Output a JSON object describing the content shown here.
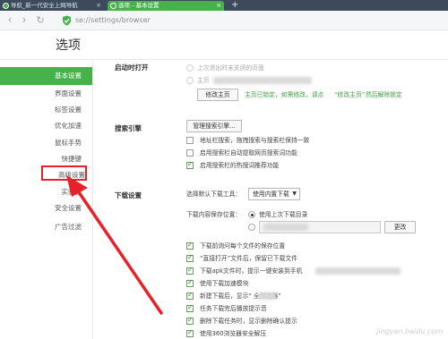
{
  "browser": {
    "tabs": [
      {
        "label": "导航_新一代安全上网导航",
        "active": false
      },
      {
        "label": "选项 - 基本设置",
        "active": true
      }
    ],
    "new_tab": "+",
    "nav": {
      "back": "‹",
      "forward": "›",
      "reload": "↻"
    },
    "url": "se://settings/browser",
    "accent": "#46b34a"
  },
  "page": {
    "title": "选项"
  },
  "sidebar": {
    "items": [
      {
        "label": "基本设置",
        "active": true
      },
      {
        "label": "界面设置"
      },
      {
        "label": "标签设置"
      },
      {
        "label": "优化加速"
      },
      {
        "label": "鼠标手势"
      },
      {
        "label": "快捷键"
      },
      {
        "label": "高级设置",
        "highlighted": true
      },
      {
        "label": "实验室"
      },
      {
        "label": "安全设置"
      },
      {
        "label": "广告过滤"
      }
    ]
  },
  "startup": {
    "title": "启动时打开",
    "option_last": "上次退出时未关闭的页面",
    "option_home": "主页",
    "modify_button": "修改主页",
    "lock_note": "主页已锁定，如需修改，请点",
    "lock_link": "“修改主页”",
    "lock_note_end": "然后解除锁定"
  },
  "search": {
    "title": "搜索引擎",
    "manage_button": "管理搜索引擎...",
    "options": [
      {
        "label": "地址栏搜索，拖拽搜索与搜索栏保持一致",
        "checked": false
      },
      {
        "label": "启用搜索栏自动提取网页搜索词功能",
        "checked": false
      },
      {
        "label": "启用搜索栏的热搜词推荐功能",
        "checked": true
      }
    ]
  },
  "download": {
    "title": "下载设置",
    "tool_label": "选择默认下载工具：",
    "tool_value": "使用内置下载",
    "location_label": "下载内容保存位置：",
    "location_last": "使用上次下载目录",
    "change_button": "更改",
    "options": [
      {
        "label": "下载前询问每个文件的保存位置",
        "checked": true
      },
      {
        "label": "“直接打开”文件后，保留已下载文件",
        "checked": true
      },
      {
        "label": "下载apk文件时，提示一键安装到手机",
        "checked": true
      },
      {
        "label": "使用下载加速模块",
        "checked": true
      },
      {
        "label": "新建下载后，显示“      全浏览器”",
        "checked": true
      },
      {
        "label": "任务下载完后播放提示音",
        "checked": true
      },
      {
        "label": "删除下载任务时，显示删除确认提示",
        "checked": true
      },
      {
        "label": "使用360浏览器安全解压",
        "checked": true
      }
    ]
  },
  "annotation": {
    "color": "#e8202a"
  }
}
